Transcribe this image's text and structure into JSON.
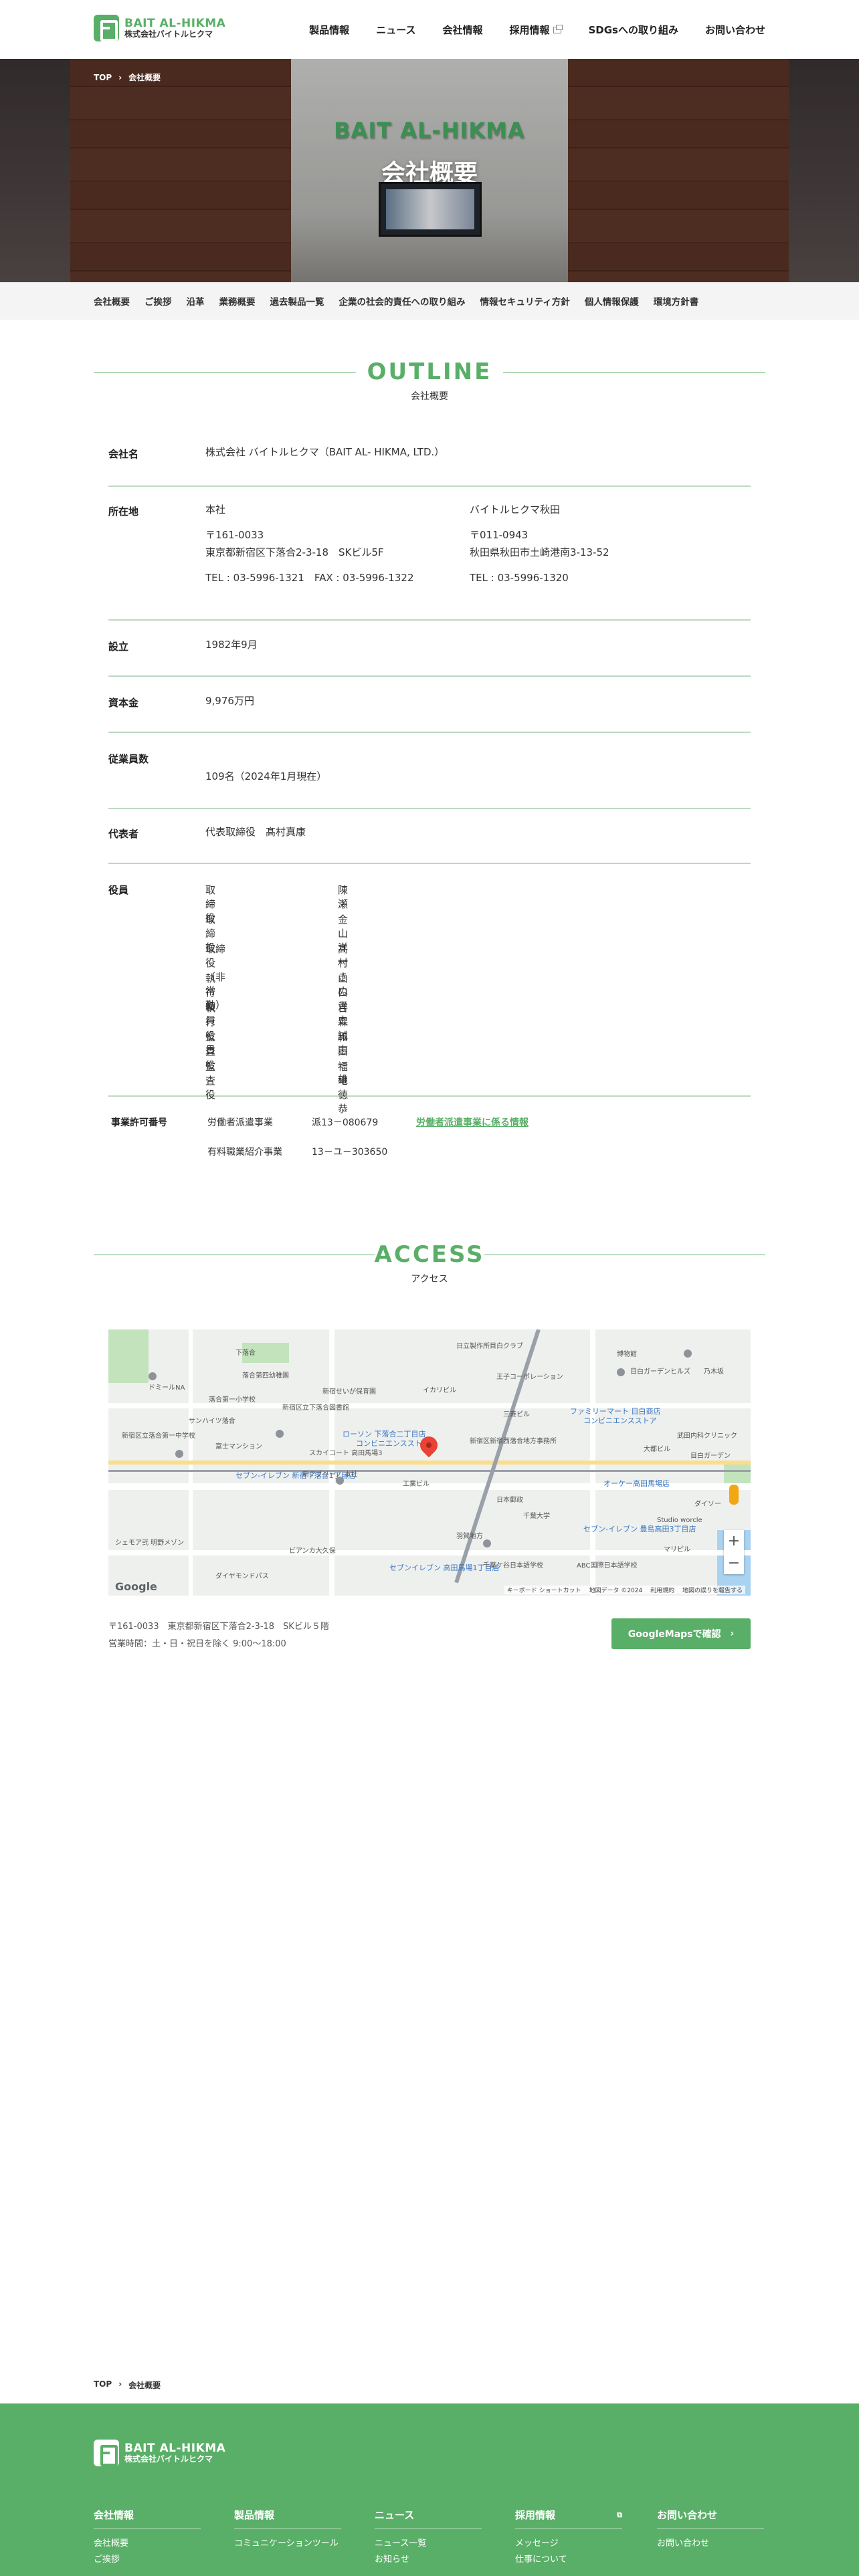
{
  "header": {
    "logo_en": "BAIT AL-HIKMA",
    "logo_jp": "株式会社バイトルヒクマ",
    "nav": [
      "製品情報",
      "ニュース",
      "会社情報",
      "採用情報",
      "SDGsへの取り組み",
      "お問い合わせ"
    ]
  },
  "hero": {
    "sign": "BAIT AL-HIKMA",
    "title": "会社概要",
    "breadcrumb": [
      "TOP",
      "会社概要"
    ]
  },
  "subnav": [
    "会社概要",
    "ご挨拶",
    "沿革",
    "業務概要",
    "過去製品一覧",
    "企業の社会的責任への取り組み",
    "情報セキュリティ方針",
    "個人情報保護",
    "環境方針書"
  ],
  "outline": {
    "title_en": "OUTLINE",
    "title_jp": "会社概要",
    "company_name": {
      "label": "会社名",
      "value": "株式会社 バイトルヒクマ（BAIT AL- HIKMA, LTD.）"
    },
    "location": {
      "label": "所在地",
      "offices": [
        {
          "name": "本社",
          "zip": "〒161-0033",
          "address": "東京都新宿区下落合2-3-18　SKビル5F",
          "tel": "TEL : 03-5996-1321　FAX : 03-5996-1322"
        },
        {
          "name": "バイトルヒクマ秋田",
          "zip": "〒011-0943",
          "address": "秋田県秋田市土崎港南3-13-52",
          "tel": "TEL : 03-5996-1320"
        }
      ]
    },
    "founded": {
      "label": "設立",
      "value": "1982年9月"
    },
    "capital": {
      "label": "資本金",
      "value": "9,976万円"
    },
    "employees": {
      "label": "従業員数",
      "value": "109名（2024年1月現在）"
    },
    "representative": {
      "label": "代表者",
      "value": "代表取締役　髙村真康"
    },
    "officers": {
      "label": "役員",
      "list": [
        {
          "title": "取締役",
          "name": "陳瀬"
        },
        {
          "title": "取締役",
          "name": "金山洋一"
        },
        {
          "title": "取締役（非常勤）",
          "name": "髙村きぬこ"
        },
        {
          "title": "執行役員",
          "name": "山口洋史"
        },
        {
          "title": "執行役員",
          "name": "吉森誠志"
        },
        {
          "title": "監査役",
          "name": "和田一雄"
        },
        {
          "title": "監査役",
          "name": "福地徳恭"
        }
      ]
    },
    "license": {
      "label": "事業許可番号",
      "items": [
        {
          "name": "労働者派遣事業",
          "number": "派13－080679",
          "link": "労働者派遣事業に係る情報"
        },
        {
          "name": "有料職業紹介事業",
          "number": "13－ユ－303650",
          "link": ""
        }
      ]
    }
  },
  "access": {
    "title_en": "ACCESS",
    "title_jp": "アクセス",
    "address": "〒161-0033　東京都新宿区下落合2-3-18　SKビル５階",
    "hours": "営業時間：土・日・祝日を除く 9:00～18:00",
    "button": "GoogleMapsで確認",
    "map": {
      "labels": [
        "下落合",
        "落合第四幼稚園",
        "新宿せいが保育園",
        "イカリビル",
        "日立製作所目白クラブ",
        "王子コーポレーション",
        "博物館",
        "目白ガーデンヒルズ",
        "乃木坂",
        "ドミールNA",
        "サンハイツ落合",
        "落合第一小学校",
        "新宿区立落合第一中学校",
        "三菱ビル",
        "新宿区新宿西落合地方事務所",
        "ファミリーマート 目白商店",
        "コンビニエンスストア",
        "大都ビル",
        "武田内科クリニック",
        "目白ガーデン",
        "新宿区立下落合図書館",
        "富士マンション",
        "ローソン 下落合二丁目店",
        "コンビニエンスストア",
        "工業ビル",
        "日本郵政",
        "セブン-イレブン 新宿下落合1丁目店",
        "新アブリーノ 本社",
        "スカイコート 高田馬場3",
        "オーケー高田馬場店",
        "ダイソー",
        "セブン-イレブン 豊島高田3丁目店",
        "Studio worcle",
        "千葉大学",
        "羽賀地方",
        "マリピル",
        "セブンイレブン 高田馬場1丁目店",
        "千葉ケ谷日本語学校",
        "ABC国際日本語学校",
        "ビアンカ大久保",
        "ダイヤモンドパス",
        "シェモア弐 明野メゾン",
        "キーボード ショートカット",
        "地図データ ©2024",
        "利用規約",
        "地図の誤りを報告する"
      ],
      "google": "Google"
    }
  },
  "breadcrumb_bottom": [
    "TOP",
    "会社概要"
  ],
  "footer": {
    "logo_en": "BAIT AL-HIKMA",
    "logo_jp": "株式会社バイトルヒクマ",
    "columns": [
      {
        "heading": "会社情報",
        "links": [
          "会社概要",
          "ご挨拶"
        ]
      },
      {
        "heading": "製品情報",
        "links": [
          "コミュニケーションツール"
        ]
      },
      {
        "heading": "ニュース",
        "links": [
          "ニュース一覧",
          "お知らせ"
        ]
      },
      {
        "heading": "採用情報",
        "links": [
          "メッセージ",
          "仕事について"
        ]
      },
      {
        "heading": "お問い合わせ",
        "links": [
          "お問い合わせ"
        ]
      }
    ]
  }
}
